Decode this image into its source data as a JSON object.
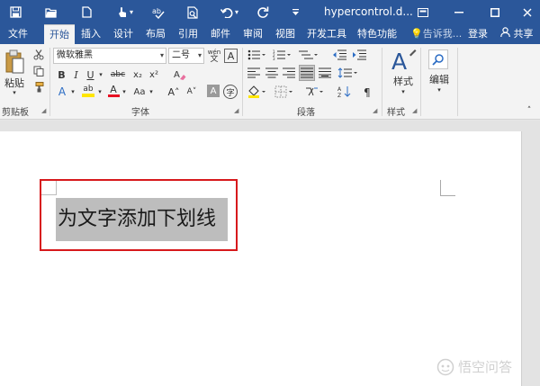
{
  "window": {
    "title": "hypercontrol.d...",
    "controls": {
      "ribbon_display": "⧉",
      "minimize": "—",
      "maximize": "☐",
      "close": "✕"
    }
  },
  "quick_access": [
    {
      "icon": "save-icon",
      "glyph": "🖫"
    },
    {
      "icon": "open-folder-icon",
      "glyph": "📂"
    },
    {
      "icon": "new-document-icon",
      "glyph": "🗋"
    },
    {
      "icon": "touch-mode-icon",
      "glyph": "☝"
    },
    {
      "icon": "spelling-check-icon",
      "glyph": "✓"
    },
    {
      "icon": "print-preview-icon",
      "glyph": "🔍"
    },
    {
      "icon": "undo-icon",
      "glyph": "↶"
    },
    {
      "icon": "redo-icon",
      "glyph": "↻"
    },
    {
      "icon": "customize-qat-icon",
      "glyph": "▾"
    }
  ],
  "tabs": [
    {
      "label": "文件"
    },
    {
      "label": "开始",
      "active": true
    },
    {
      "label": "插入"
    },
    {
      "label": "设计"
    },
    {
      "label": "布局"
    },
    {
      "label": "引用"
    },
    {
      "label": "邮件"
    },
    {
      "label": "审阅"
    },
    {
      "label": "视图"
    },
    {
      "label": "开发工具"
    },
    {
      "label": "特色功能"
    }
  ],
  "tell_me": "告诉我...",
  "sign_in": "登录",
  "share": "共享",
  "ribbon": {
    "clipboard": {
      "label": "剪贴板",
      "paste": "粘贴",
      "cut_glyph": "✂",
      "copy_glyph": "⎘",
      "format_painter_glyph": "🖌"
    },
    "font": {
      "label": "字体",
      "font_name": "微软雅黑",
      "font_size": "二号",
      "phonetic_glyph": "wén\n文",
      "char_border_glyph": "A",
      "bold": "B",
      "italic": "I",
      "underline": "U",
      "strikethrough": "abc",
      "subscript": "x₂",
      "superscript": "x²",
      "clear_format_glyph": "A",
      "text_effects": "A",
      "highlight": "ab",
      "font_color": "A",
      "change_case": "Aa",
      "grow_font": "A˄",
      "shrink_font": "A˅",
      "char_shading": "A",
      "enclose_char": "字"
    },
    "paragraph": {
      "label": "段落"
    },
    "styles": {
      "label": "样式",
      "button": "样式"
    },
    "editing": {
      "button": "编辑"
    }
  },
  "document": {
    "selected_text": "为文字添加下划线"
  },
  "watermark": "悟空问答",
  "colors": {
    "title_bar": "#2b579a",
    "ribbon": "#f3f3f3",
    "highlight_yellow": "#ffe600",
    "font_red": "#e81123",
    "annotation_red": "#d7191c",
    "selection_gray": "#bdbdbd"
  }
}
